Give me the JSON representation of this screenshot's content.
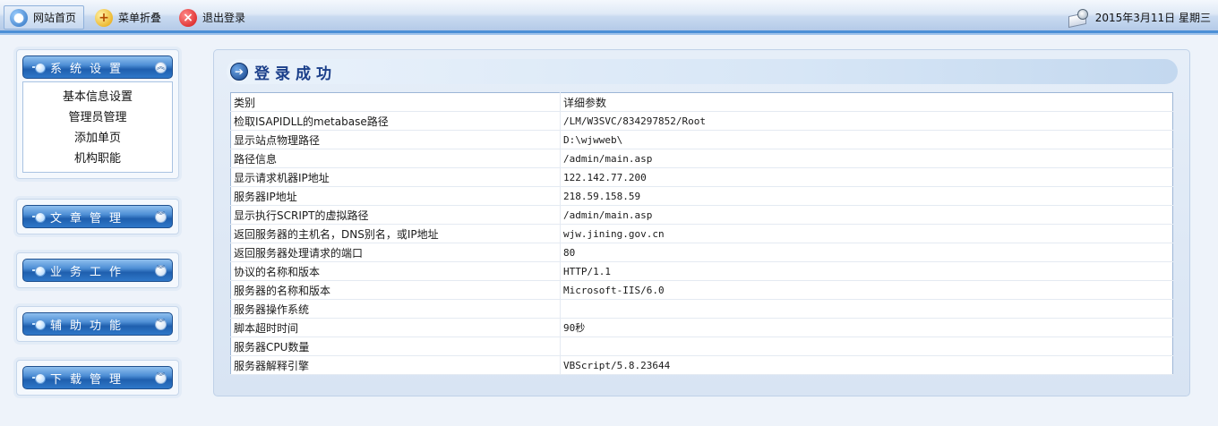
{
  "topbar": {
    "buttons": [
      {
        "label": "网站首页",
        "icon": "home-globe-icon"
      },
      {
        "label": "菜单折叠",
        "icon": "fold-plus-icon"
      },
      {
        "label": "退出登录",
        "icon": "logout-x-icon"
      }
    ],
    "date": "2015年3月11日 星期三",
    "date_icon": "calendar-clock-icon"
  },
  "sidebar": {
    "panels": [
      {
        "title": "系统设置",
        "expanded": true,
        "items": [
          "基本信息设置",
          "管理员管理",
          "添加单页",
          "机构职能"
        ]
      },
      {
        "title": "文章管理",
        "expanded": false,
        "items": []
      },
      {
        "title": "业务工作",
        "expanded": false,
        "items": []
      },
      {
        "title": "辅助功能",
        "expanded": false,
        "items": []
      },
      {
        "title": "下载管理",
        "expanded": false,
        "items": []
      }
    ]
  },
  "main": {
    "title": "登录成功",
    "table": {
      "header": [
        "类别",
        "详细参数"
      ],
      "rows": [
        [
          "检取ISAPIDLL的metabase路径",
          "/LM/W3SVC/834297852/Root"
        ],
        [
          "显示站点物理路径",
          "D:\\wjwweb\\"
        ],
        [
          "路径信息",
          "/admin/main.asp"
        ],
        [
          "显示请求机器IP地址",
          "122.142.77.200"
        ],
        [
          "服务器IP地址",
          "218.59.158.59"
        ],
        [
          "显示执行SCRIPT的虚拟路径",
          "/admin/main.asp"
        ],
        [
          "返回服务器的主机名，DNS别名，或IP地址",
          "wjw.jining.gov.cn"
        ],
        [
          "返回服务器处理请求的端口",
          "80"
        ],
        [
          "协议的名称和版本",
          "HTTP/1.1"
        ],
        [
          "服务器的名称和版本",
          "Microsoft-IIS/6.0"
        ],
        [
          "服务器操作系统",
          ""
        ],
        [
          "脚本超时时间",
          "90秒"
        ],
        [
          "服务器CPU数量",
          ""
        ],
        [
          "服务器解释引擎",
          "VBScript/5.8.23644"
        ]
      ]
    }
  }
}
